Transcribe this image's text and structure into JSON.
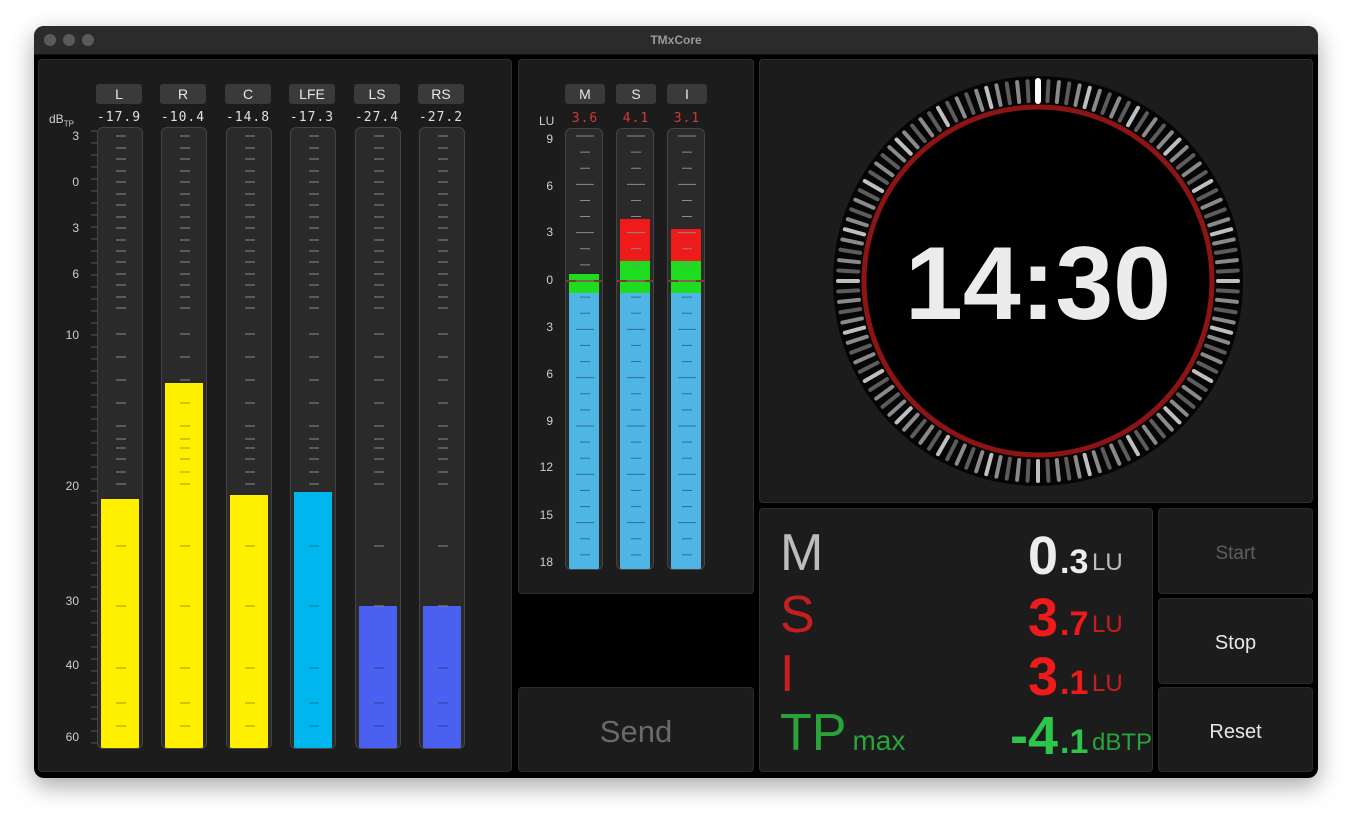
{
  "app": {
    "title": "TMxCore"
  },
  "colors": {
    "yellow": "#ffef00",
    "cyan": "#00b6ef",
    "blue": "#4a60f0",
    "lu_blue": "#4eb5e4",
    "green": "#1edc1e",
    "red": "#ef1a1a",
    "label_red": "#c71f1f",
    "label_green": "#28a43a"
  },
  "channels": {
    "unit": "dB",
    "unit_sub": "TP",
    "scale": [
      "3",
      "0",
      "3",
      "6",
      "10",
      "20",
      "30",
      "40",
      "60"
    ],
    "items": [
      {
        "label": "L",
        "value": "-17.9",
        "fill": 0.401,
        "color": "yellow"
      },
      {
        "label": "R",
        "value": "-10.4",
        "fill": 0.587,
        "color": "yellow"
      },
      {
        "label": "C",
        "value": "-14.8",
        "fill": 0.406,
        "color": "yellow"
      },
      {
        "label": "LFE",
        "value": "-17.3",
        "fill": 0.412,
        "color": "cyan"
      },
      {
        "label": "LS",
        "value": "-27.4",
        "fill": 0.228,
        "color": "blue"
      },
      {
        "label": "RS",
        "value": "-27.2",
        "fill": 0.228,
        "color": "blue"
      }
    ]
  },
  "loudness_meters": {
    "unit": "LU",
    "scale": [
      "9",
      "6",
      "3",
      "0",
      "3",
      "6",
      "9",
      "12",
      "15",
      "18"
    ],
    "items": [
      {
        "label": "M",
        "value": "3.6",
        "lu": 0.3
      },
      {
        "label": "S",
        "value": "4.1",
        "lu": 3.7
      },
      {
        "label": "I",
        "value": "3.1",
        "lu": 3.1
      }
    ]
  },
  "clock": {
    "time": "14:30"
  },
  "readings": [
    {
      "label": "M",
      "main": "0",
      "decimal": ".3",
      "unit": "LU",
      "label_color": "#bdbdbd",
      "value_color": "#ededed",
      "unit_color": "#bdbdbd"
    },
    {
      "label": "S",
      "main": "3",
      "decimal": ".7",
      "unit": "LU",
      "label_color": "#c71f1f",
      "value_color": "#ef1a1a",
      "unit_color": "#c71f1f"
    },
    {
      "label": "I",
      "main": "3",
      "decimal": ".1",
      "unit": "LU",
      "label_color": "#c71f1f",
      "value_color": "#ef1a1a",
      "unit_color": "#c71f1f"
    },
    {
      "label": "TP",
      "label_sub": "max",
      "main": "-4",
      "decimal": ".1",
      "unit": "dBTP",
      "label_color": "#28a43a",
      "value_color": "#2bc64a",
      "unit_color": "#28a43a"
    }
  ],
  "buttons": {
    "start": "Start",
    "stop": "Stop",
    "reset": "Reset",
    "send": "Send"
  }
}
